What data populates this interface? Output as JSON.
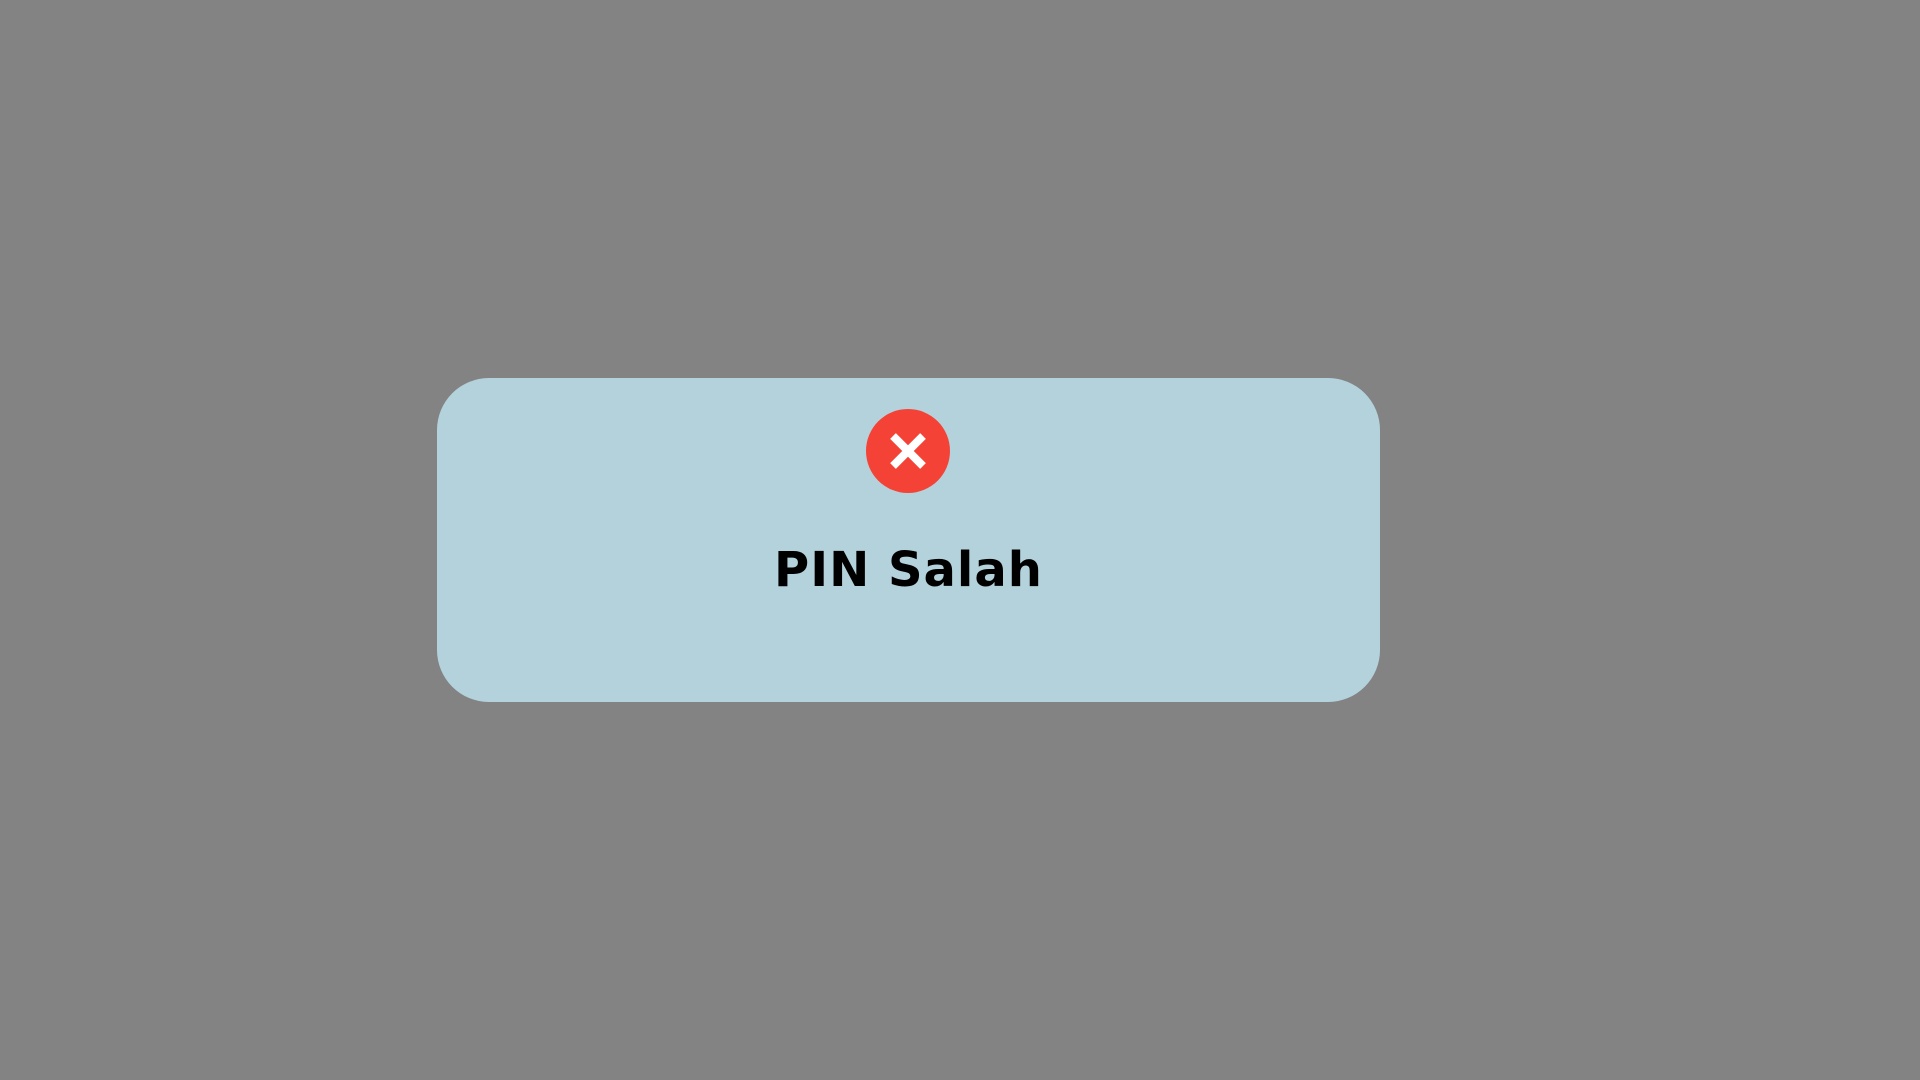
{
  "dialog": {
    "title": "PIN Salah",
    "icon": "error-x-icon"
  },
  "colors": {
    "overlay": "#838383",
    "dialog_background": "#B4D2DC",
    "error": "#F44336",
    "icon_glyph": "#FFFFFF",
    "text": "#000000"
  }
}
